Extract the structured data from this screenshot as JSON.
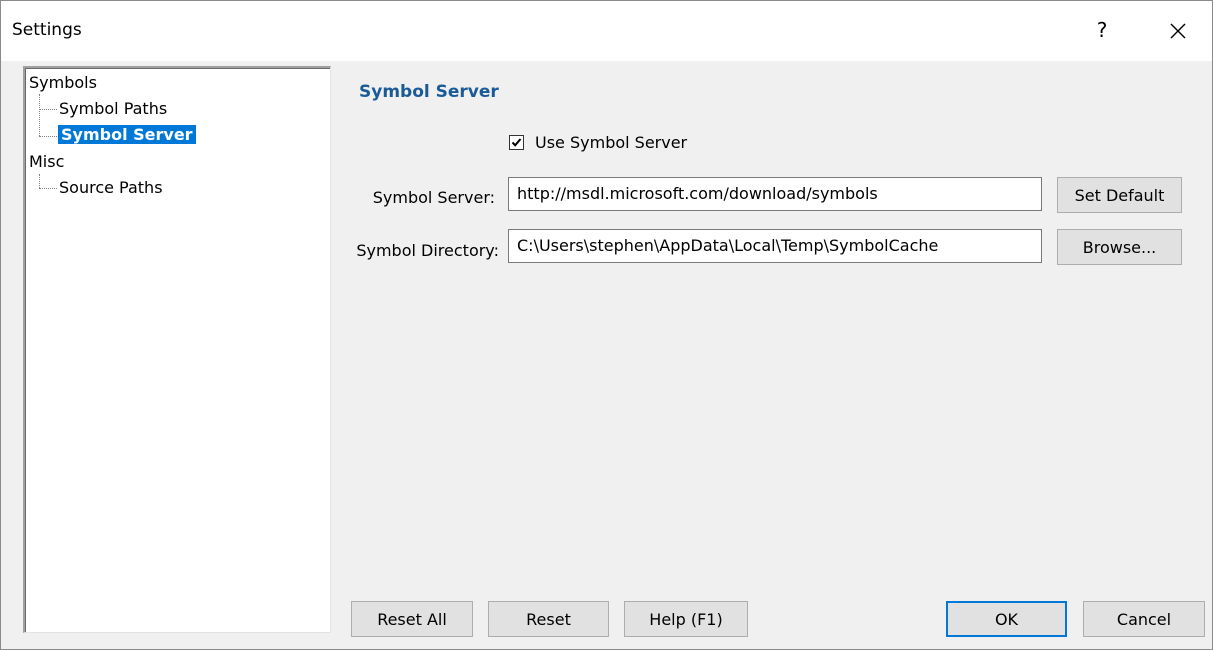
{
  "window": {
    "title": "Settings",
    "help_glyph": "?",
    "close_icon": "close-icon"
  },
  "tree": {
    "groups": [
      {
        "label": "Symbols",
        "children": [
          "Symbol Paths",
          "Symbol Server"
        ]
      },
      {
        "label": "Misc",
        "children": [
          "Source Paths"
        ]
      }
    ],
    "selected": "Symbol Server"
  },
  "panel": {
    "title": "Symbol Server",
    "use_server_label": "Use Symbol Server",
    "use_server_checked": true,
    "server_label": "Symbol Server:",
    "server_value": "http://msdl.microsoft.com/download/symbols",
    "set_default_label": "Set Default",
    "directory_label": "Symbol Directory:",
    "directory_value": "C:\\Users\\stephen\\AppData\\Local\\Temp\\SymbolCache",
    "browse_label": "Browse..."
  },
  "footer": {
    "reset_all": "Reset All",
    "reset": "Reset",
    "help": "Help (F1)",
    "ok": "OK",
    "cancel": "Cancel"
  },
  "colors": {
    "accent": "#0078d7",
    "section_title": "#1a5a96"
  }
}
